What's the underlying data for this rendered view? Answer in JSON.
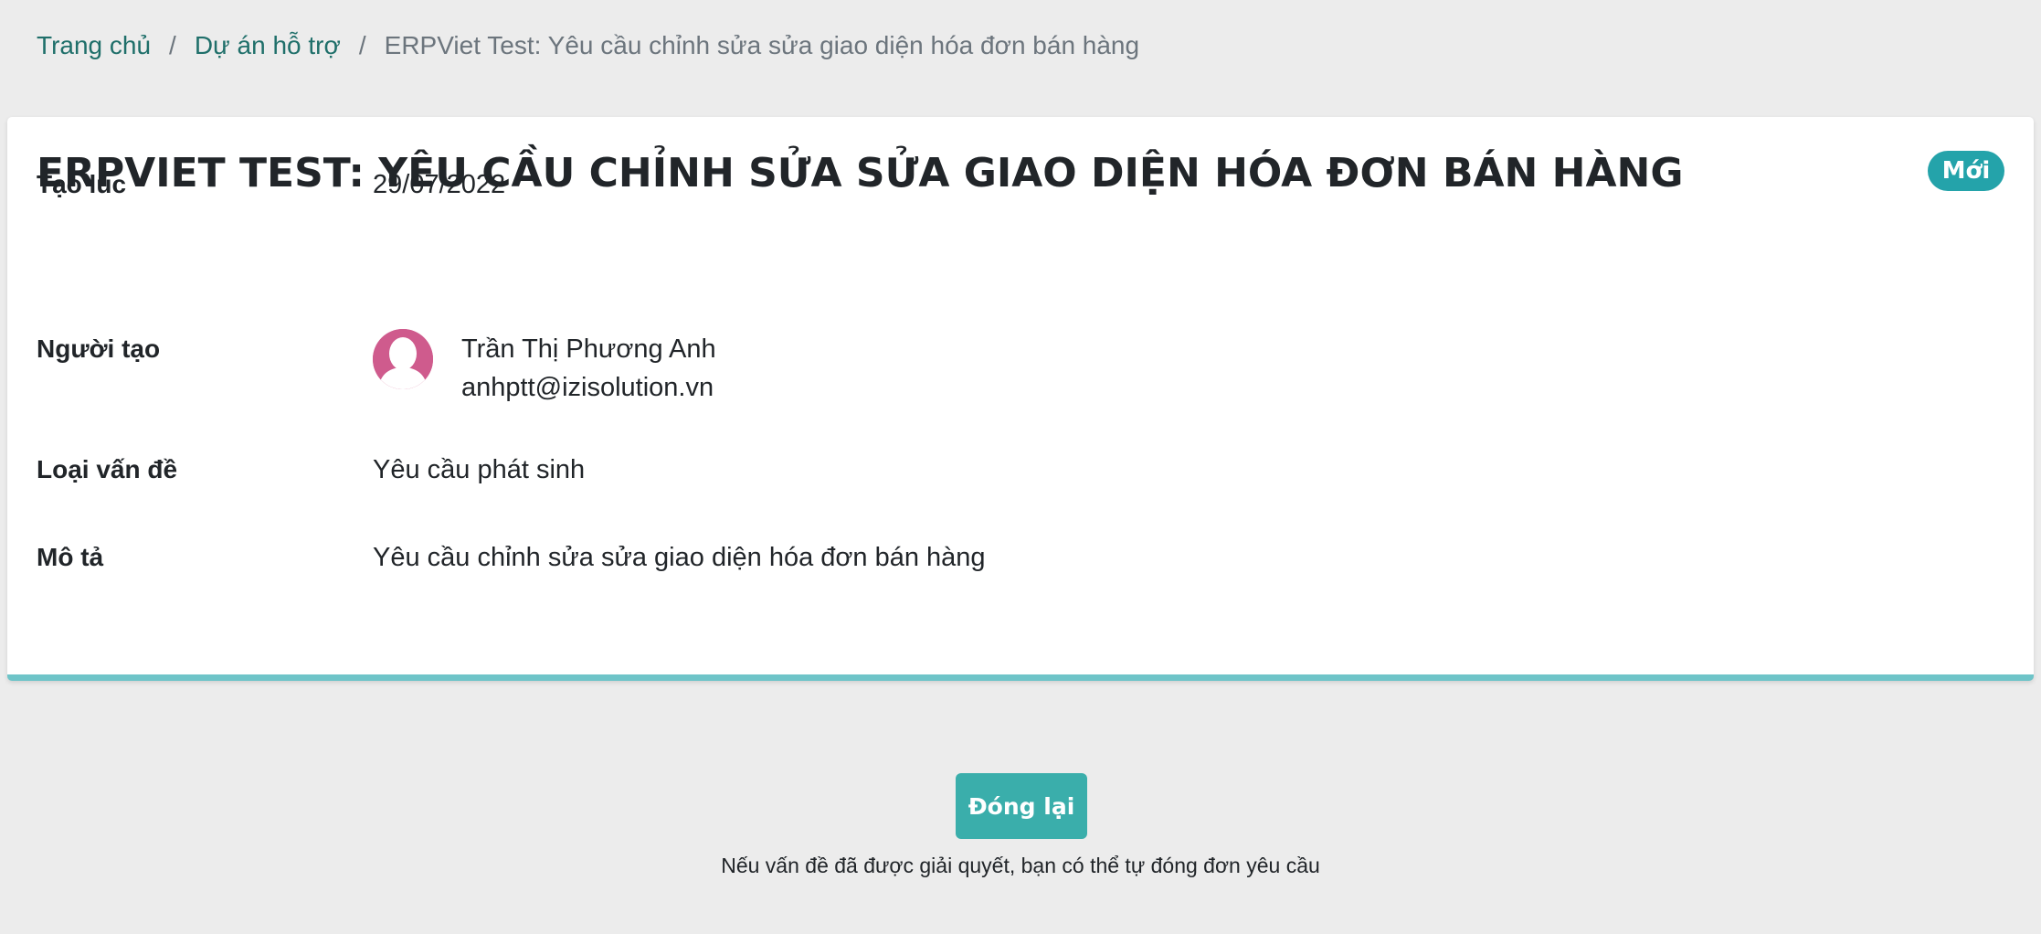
{
  "breadcrumb": {
    "home": "Trang chủ",
    "projects": "Dự án hỗ trợ",
    "current": "ERPViet Test: Yêu cầu chỉnh sửa sửa giao diện hóa đơn bán hàng",
    "separator": "/"
  },
  "ticket": {
    "title": "ERPVIET TEST: YÊU CẦU CHỈNH SỬA SỬA GIAO DIỆN HÓA ĐƠN BÁN HÀNG",
    "status": "Mới",
    "status_color": "#24a3aa",
    "fields": {
      "created_label": "Tạo lúc",
      "created_value": "29/07/2022",
      "creator_label": "Người tạo",
      "creator_name": "Trần Thị Phương Anh",
      "creator_email": "anhptt@izisolution.vn",
      "type_label": "Loại vấn đề",
      "type_value": "Yêu cầu phát sinh",
      "desc_label": "Mô tả",
      "desc_value": "Yêu cầu chỉnh sửa sửa giao diện hóa đơn bán hàng"
    },
    "avatar_icon": "user-silhouette-icon",
    "avatar_color": "#cf5b8d"
  },
  "actions": {
    "close_label": "Đóng lại",
    "close_hint": "Nếu vấn đề đã được giải quyết, bạn có thể tự đóng đơn yêu cầu",
    "button_color": "#3aaeab"
  },
  "colors": {
    "background": "#ececec",
    "link": "#1f6f6a",
    "card_accent": "#6ec4c8"
  }
}
